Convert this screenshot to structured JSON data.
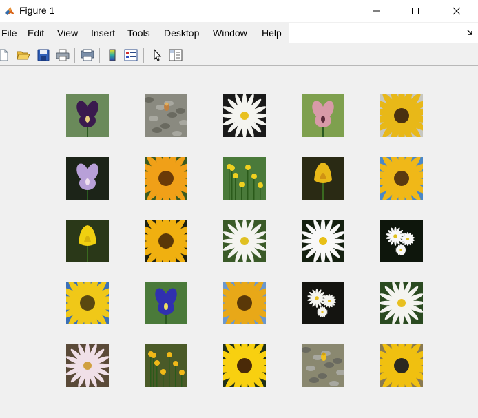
{
  "window": {
    "title": "Figure 1"
  },
  "menu": [
    "File",
    "Edit",
    "View",
    "Insert",
    "Tools",
    "Desktop",
    "Window",
    "Help"
  ],
  "toolbar": [
    "new-figure-icon",
    "open-file-icon",
    "save-icon",
    "print-icon",
    "print-preview-icon",
    "insert-colorbar-icon",
    "insert-legend-icon",
    "edit-plot-icon",
    "property-inspector-icon"
  ],
  "images": [
    {
      "subject": "purple iris",
      "bg": "#6a8a5a",
      "petal": "#3a1a4e",
      "center": "#e8d080",
      "type": "iris"
    },
    {
      "subject": "small bud among rocks",
      "bg": "#8a8a80",
      "petal": "#c08040",
      "center": "#e0b060",
      "type": "rocks"
    },
    {
      "subject": "white daisy",
      "bg": "#1a1a1a",
      "petal": "#f4f4f0",
      "center": "#e8c020",
      "type": "daisy"
    },
    {
      "subject": "pink iris",
      "bg": "#7ea04e",
      "petal": "#d89aa8",
      "center": "#5a2a3a",
      "type": "iris"
    },
    {
      "subject": "sunflower by fence",
      "bg": "#c8c8c0",
      "petal": "#e8b818",
      "center": "#4a3010",
      "type": "sunflower"
    },
    {
      "subject": "lavender iris",
      "bg": "#1c2418",
      "petal": "#b8a0d8",
      "center": "#f0e0f0",
      "type": "iris"
    },
    {
      "subject": "orange sunflower",
      "bg": "#3a5a20",
      "petal": "#f0a018",
      "center": "#6a3a08",
      "type": "sunflower"
    },
    {
      "subject": "yellow wildflowers",
      "bg": "#4a7a3a",
      "petal": "#f0d020",
      "center": "#d0a010",
      "type": "field"
    },
    {
      "subject": "yellow lily",
      "bg": "#2a2a14",
      "petal": "#e8b818",
      "center": "#c07810",
      "type": "tulip"
    },
    {
      "subject": "sunflower under blue sky",
      "bg": "#4a88c8",
      "petal": "#f0b818",
      "center": "#5a3a10",
      "type": "sunflower"
    },
    {
      "subject": "yellow tulip",
      "bg": "#2a3818",
      "petal": "#f0d010",
      "center": "#c8a008",
      "type": "tulip"
    },
    {
      "subject": "golden sunflower",
      "bg": "#1e2010",
      "petal": "#f0b010",
      "center": "#5a3808",
      "type": "sunflower"
    },
    {
      "subject": "white daisy on green",
      "bg": "#3a5a28",
      "petal": "#f4f4f0",
      "center": "#e0c020",
      "type": "daisy"
    },
    {
      "subject": "white daisy on dark",
      "bg": "#142010",
      "petal": "#f8f8f8",
      "center": "#e8c018",
      "type": "daisy"
    },
    {
      "subject": "small daisies",
      "bg": "#0e160c",
      "petal": "#f8f8f8",
      "center": "#e0c020",
      "type": "daisies"
    },
    {
      "subject": "sunflower with blue sky",
      "bg": "#3a70b8",
      "petal": "#f0c818",
      "center": "#5a4810",
      "type": "sunflower"
    },
    {
      "subject": "blue iris",
      "bg": "#4a7a3a",
      "petal": "#3030b0",
      "center": "#f0e060",
      "type": "iris"
    },
    {
      "subject": "sunflower by tree",
      "bg": "#6a98d0",
      "petal": "#e8a818",
      "center": "#5a3808",
      "type": "sunflower"
    },
    {
      "subject": "daisies on dark",
      "bg": "#141410",
      "petal": "#f4f4f0",
      "center": "#e8c020",
      "type": "daisies"
    },
    {
      "subject": "white daisy on green",
      "bg": "#2a4a20",
      "petal": "#f4f4f0",
      "center": "#e8c020",
      "type": "daisy"
    },
    {
      "subject": "pale pink daisy",
      "bg": "#5a4a38",
      "petal": "#f0e0e8",
      "center": "#d0a040",
      "type": "daisy"
    },
    {
      "subject": "yellow wildflowers on stems",
      "bg": "#4a5a28",
      "petal": "#f0b818",
      "center": "#d09010",
      "type": "field"
    },
    {
      "subject": "large sunflower",
      "bg": "#203018",
      "petal": "#f8d010",
      "center": "#4a2a08",
      "type": "sunflower"
    },
    {
      "subject": "small yellow flower in grass",
      "bg": "#8a8870",
      "petal": "#f0c020",
      "center": "#d0a010",
      "type": "rocks"
    },
    {
      "subject": "sunflower dark center",
      "bg": "#8a7a50",
      "petal": "#f0c010",
      "center": "#2a2820",
      "type": "sunflower"
    }
  ]
}
